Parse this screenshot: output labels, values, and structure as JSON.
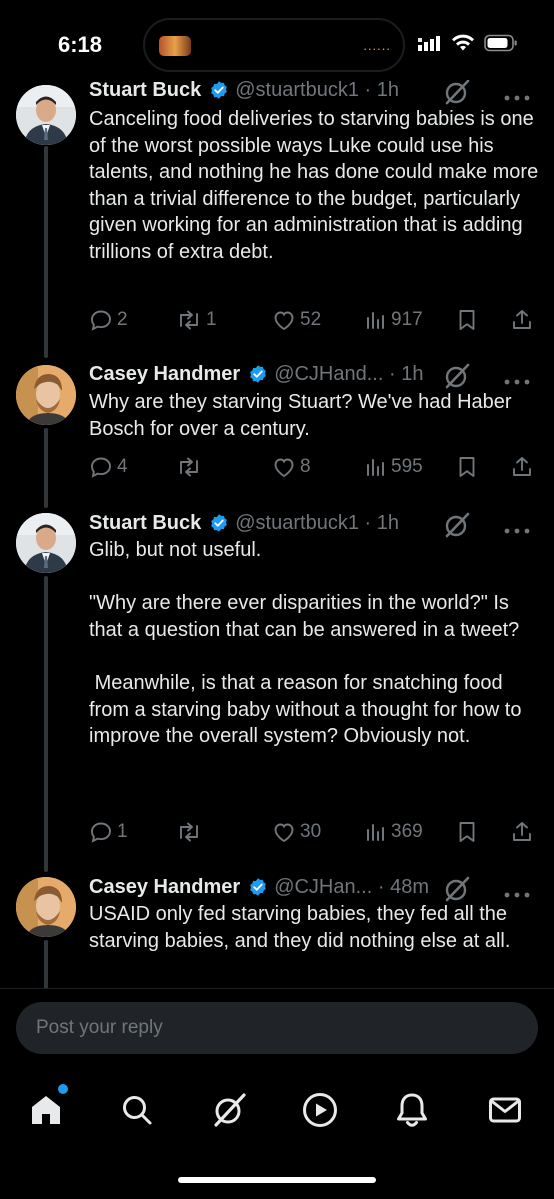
{
  "status_bar": {
    "time": "6:18",
    "island_dots": "......"
  },
  "tweets": [
    {
      "author": "Stuart Buck",
      "handle": "@stuartbuck1 · 1h",
      "avatar": "stuart-avatar",
      "text": "Canceling food deliveries to starving babies is one of the worst possible ways Luke could use his talents, and nothing he has done could make more than a trivial difference to the budget, particularly given working for an administration that is adding trillions of extra debt.",
      "replies": "2",
      "reposts": "1",
      "likes": "52",
      "views": "917"
    },
    {
      "author": "Casey Handmer",
      "handle": "@CJHand... · 1h",
      "avatar": "casey-avatar",
      "text": "Why are they starving Stuart? We've had Haber Bosch for over a century.",
      "replies": "4",
      "reposts": "",
      "likes": "8",
      "views": "595"
    },
    {
      "author": "Stuart Buck",
      "handle": "@stuartbuck1 · 1h",
      "avatar": "stuart-avatar",
      "text": "Glib, but not useful.\n\n\"Why are there ever disparities in the world?\" Is that a question that can be answered in a tweet?\n\n Meanwhile, is that a reason for snatching food from a starving baby without a thought for how to improve the overall system? Obviously not.",
      "replies": "1",
      "reposts": "",
      "likes": "30",
      "views": "369"
    },
    {
      "author": "Casey Handmer",
      "handle": "@CJHan... · 48m",
      "avatar": "casey-avatar",
      "text": "USAID only fed starving babies, they fed all the starving babies, and they did nothing else at all.",
      "replies": "",
      "reposts": "",
      "likes": "",
      "views": ""
    }
  ],
  "reply": {
    "placeholder": "Post your reply"
  },
  "tabs": [
    "home-icon",
    "search-icon",
    "grok-icon",
    "video-icon",
    "notifications-icon",
    "messages-icon"
  ],
  "colors": {
    "background": "#000000",
    "text": "#e7e9ea",
    "muted": "#71767b",
    "accent": "#1d9bf0",
    "thread_line": "#333639"
  }
}
